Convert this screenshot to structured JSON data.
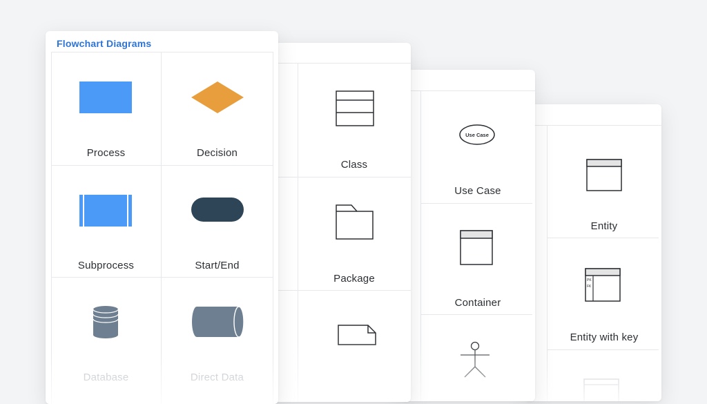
{
  "flowchart_panel": {
    "title": "Flowchart Diagrams",
    "shapes": [
      "Process",
      "Decision",
      "Subprocess",
      "Start/End",
      "Database",
      "Direct Data"
    ]
  },
  "uml_class_panel": {
    "shapes": [
      "Class",
      "Package"
    ]
  },
  "use_case_panel": {
    "shapes": [
      "Use Case",
      "Container"
    ],
    "use_case_text": "Use Case"
  },
  "er_panel": {
    "shapes": [
      "Entity",
      "Entity with key"
    ],
    "pk_text": "PK",
    "fk_text": "FK"
  },
  "colors": {
    "accent": "#2e74d6",
    "process": "#4c9af7",
    "decision": "#e89e3c",
    "start_end": "#2d4556",
    "database": "#6e7f92"
  }
}
